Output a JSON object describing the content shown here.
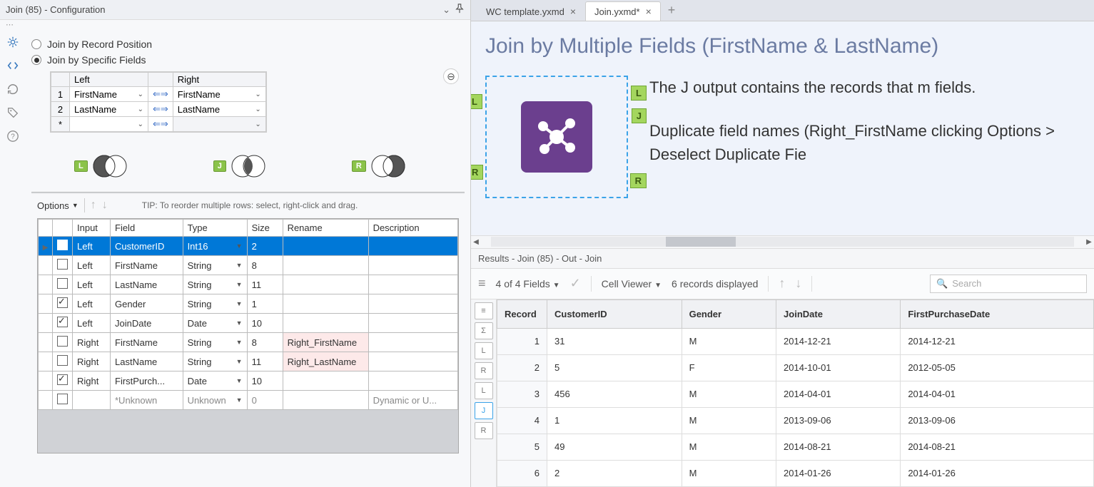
{
  "panel": {
    "title": "Join (85) - Configuration",
    "radio1": "Join by Record Position",
    "radio2": "Join by Specific Fields",
    "mapping": {
      "left_header": "Left",
      "right_header": "Right",
      "rows": [
        {
          "n": "1",
          "left": "FirstName",
          "right": "FirstName"
        },
        {
          "n": "2",
          "left": "LastName",
          "right": "LastName"
        },
        {
          "n": "*",
          "left": "",
          "right": ""
        }
      ]
    },
    "venn": {
      "l": "L",
      "j": "J",
      "r": "R"
    },
    "options_label": "Options",
    "tip": "TIP: To reorder multiple rows: select, right-click and drag.",
    "fields_headers": {
      "input": "Input",
      "field": "Field",
      "type": "Type",
      "size": "Size",
      "rename": "Rename",
      "description": "Description"
    },
    "fields": [
      {
        "checked": true,
        "selected": true,
        "input": "Left",
        "field": "CustomerID",
        "type": "Int16",
        "size": "2",
        "rename": "",
        "desc": ""
      },
      {
        "checked": false,
        "input": "Left",
        "field": "FirstName",
        "type": "String",
        "size": "8",
        "rename": "",
        "desc": ""
      },
      {
        "checked": false,
        "input": "Left",
        "field": "LastName",
        "type": "String",
        "size": "11",
        "rename": "",
        "desc": ""
      },
      {
        "checked": true,
        "input": "Left",
        "field": "Gender",
        "type": "String",
        "size": "1",
        "rename": "",
        "desc": ""
      },
      {
        "checked": true,
        "input": "Left",
        "field": "JoinDate",
        "type": "Date",
        "size": "10",
        "rename": "",
        "desc": ""
      },
      {
        "checked": false,
        "input": "Right",
        "field": "FirstName",
        "type": "String",
        "size": "8",
        "rename": "Right_FirstName",
        "desc": ""
      },
      {
        "checked": false,
        "input": "Right",
        "field": "LastName",
        "type": "String",
        "size": "11",
        "rename": "Right_LastName",
        "desc": ""
      },
      {
        "checked": true,
        "input": "Right",
        "field": "FirstPurch...",
        "type": "Date",
        "size": "10",
        "rename": "",
        "desc": ""
      },
      {
        "checked": false,
        "unknown": true,
        "input": "",
        "field": "*Unknown",
        "type": "Unknown",
        "size": "0",
        "rename": "",
        "desc": "Dynamic or U..."
      }
    ]
  },
  "tabs": [
    {
      "label": "WC template.yxmd",
      "active": false
    },
    {
      "label": "Join.yxmd*",
      "active": true
    }
  ],
  "canvas": {
    "title": "Join by Multiple Fields (FirstName & LastName)",
    "para1": "The J output contains the records that m fields.",
    "para2": "Duplicate field names (Right_FirstName clicking Options > Deselect Duplicate Fie",
    "anchors": {
      "l": "L",
      "r": "R",
      "j": "J"
    }
  },
  "results": {
    "header": "Results - Join (85) - Out - Join",
    "fields_summary": "4 of 4 Fields",
    "cell_viewer": "Cell Viewer",
    "records_displayed": "6 records displayed",
    "search_placeholder": "Search",
    "side_buttons": [
      "≡",
      "Σ",
      "L",
      "R",
      "L",
      "J",
      "R"
    ],
    "columns": [
      "Record",
      "CustomerID",
      "Gender",
      "JoinDate",
      "FirstPurchaseDate"
    ],
    "rows": [
      {
        "rec": "1",
        "cid": "31",
        "g": "M",
        "jd": "2014-12-21",
        "fp": "2014-12-21"
      },
      {
        "rec": "2",
        "cid": "5",
        "g": "F",
        "jd": "2014-10-01",
        "fp": "2012-05-05"
      },
      {
        "rec": "3",
        "cid": "456",
        "g": "M",
        "jd": "2014-04-01",
        "fp": "2014-04-01"
      },
      {
        "rec": "4",
        "cid": "1",
        "g": "M",
        "jd": "2013-09-06",
        "fp": "2013-09-06"
      },
      {
        "rec": "5",
        "cid": "49",
        "g": "M",
        "jd": "2014-08-21",
        "fp": "2014-08-21"
      },
      {
        "rec": "6",
        "cid": "2",
        "g": "M",
        "jd": "2014-01-26",
        "fp": "2014-01-26"
      }
    ]
  }
}
